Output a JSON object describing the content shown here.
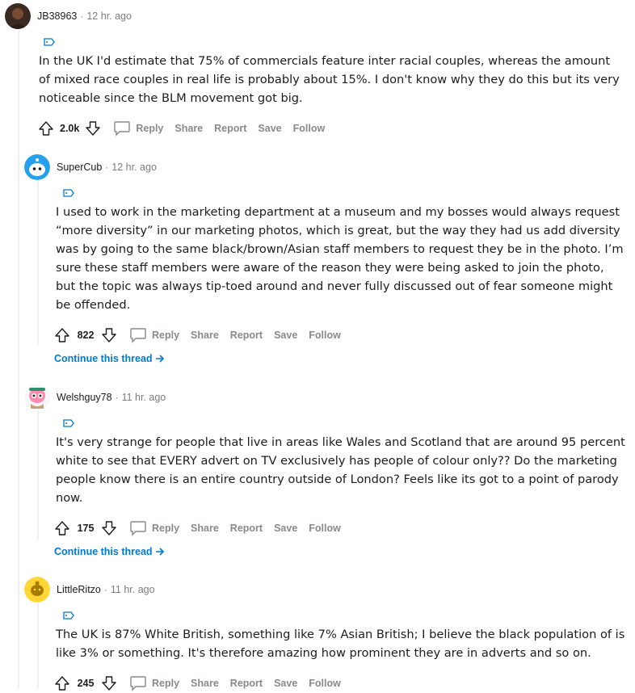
{
  "comments": [
    {
      "username": "JB38963",
      "separator": "·",
      "time": "12 hr. ago",
      "text": "In the UK I'd estimate that 75% of commercials feature inter racial couples, whereas the amount of mixed race couples in real life is probably about 15%. I don't know why they do this but its very noticeable since the BLM movement got big.",
      "score": "2.0k",
      "actions": {
        "reply": "Reply",
        "share": "Share",
        "report": "Report",
        "save": "Save",
        "follow": "Follow"
      }
    },
    {
      "username": "SuperCub",
      "separator": "·",
      "time": "12 hr. ago",
      "text": "I used to work in the marketing department at a museum and my bosses would always request “more diversity” in our marketing photos, which is great, but the way they had us add diversity was by going to the same black/brown/Asian staff members to request they be in the photo. I’m sure these staff members were aware of the reason they were being asked to join the photo, but the topic was always tip-toed around and never fully discussed out of fear someone might be offended.",
      "score": "822",
      "actions": {
        "reply": "Reply",
        "share": "Share",
        "report": "Report",
        "save": "Save",
        "follow": "Follow"
      },
      "continue_label": "Continue this thread"
    },
    {
      "username": "Welshguy78",
      "separator": "·",
      "time": "11 hr. ago",
      "text": "It's very strange for people that live in areas like Wales and Scotland that are around 95 percent white to see that EVERY advert on TV exclusively has people of colour only?? Do the marketing people know there is an entire country outside of London? Feels like its got to a point of parody now.",
      "score": "175",
      "actions": {
        "reply": "Reply",
        "share": "Share",
        "report": "Report",
        "save": "Save",
        "follow": "Follow"
      },
      "continue_label": "Continue this thread"
    },
    {
      "username": "LittleRitzo",
      "separator": "·",
      "time": "11 hr. ago",
      "text": "The UK is 87% White British, something like 7% Asian British; I believe the black population of is like 3% or something. It's therefore amazing how prominent they are in adverts and so on.",
      "score": "245",
      "actions": {
        "reply": "Reply",
        "share": "Share",
        "report": "Report",
        "save": "Save",
        "follow": "Follow"
      }
    }
  ],
  "icons": {
    "upvote": "upvote-arrow-icon",
    "downvote": "downvote-arrow-icon",
    "reply": "speech-bubble-icon",
    "flair": "tag-icon",
    "continue": "arrow-right-icon"
  },
  "colors": {
    "link": "#0079d3",
    "muted": "#878a8c",
    "text": "#1c1c1c"
  }
}
